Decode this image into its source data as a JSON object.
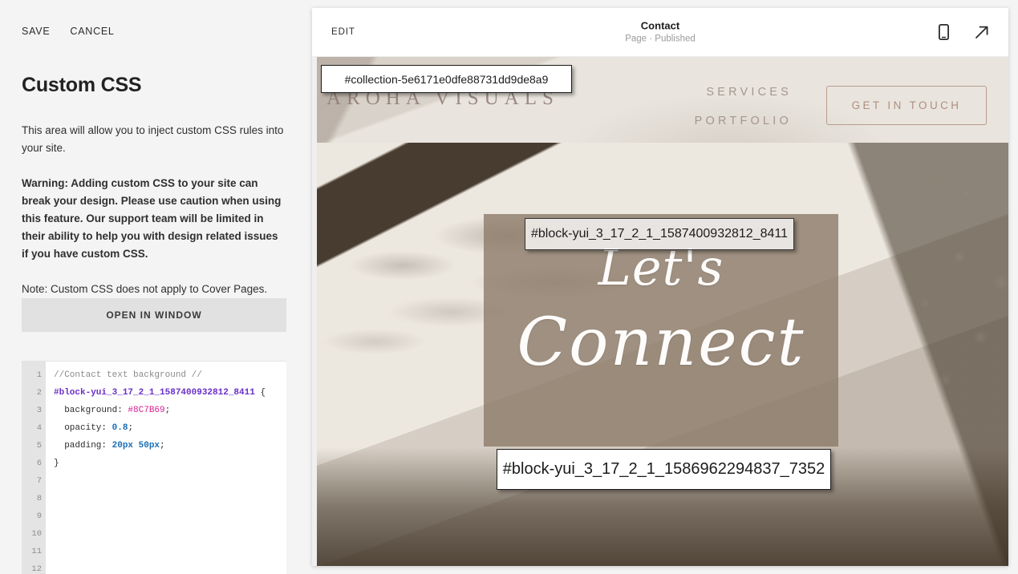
{
  "left_panel": {
    "actions": [
      {
        "id": "save",
        "label": "SAVE"
      },
      {
        "id": "cancel",
        "label": "CANCEL"
      }
    ],
    "title": "Custom CSS",
    "paragraphs": [
      {
        "text": "This area will allow you to inject custom CSS rules into your site.",
        "strong": false
      },
      {
        "text": "Warning: Adding custom CSS to your site can break your design. Please use caution when using this feature. Our support team will be limited in their ability to help you with design related issues if you have custom CSS.",
        "strong": true
      },
      {
        "text": "Note: Custom CSS does not apply to Cover Pages.",
        "strong": false
      }
    ],
    "open_window_label": "OPEN IN WINDOW"
  },
  "editor": {
    "line_numbers": [
      "1",
      "2",
      "3",
      "4",
      "5",
      "6",
      "7",
      "8",
      "9",
      "10",
      "11",
      "12"
    ],
    "lines": [
      {
        "n": 1,
        "comment": "//Contact text background //"
      },
      {
        "n": 2,
        "selector": "#block-yui_3_17_2_1_1587400932812_8411",
        "brace": " {"
      },
      {
        "n": 3,
        "prop": "  background: ",
        "hex": "#8C7B69",
        "semi": ";"
      },
      {
        "n": 4,
        "prop": "  opacity: ",
        "num": "0.8",
        "semi": ";"
      },
      {
        "n": 5,
        "prop": "  padding: ",
        "num": "20px 50px",
        "semi": ";"
      },
      {
        "n": 6,
        "brace": "}"
      }
    ],
    "colors": {
      "comment": "#8a8a8a",
      "selector": "#6b2fc9",
      "hex_value": "#d6208f",
      "number": "#1a6fb5",
      "text": "#2b2b2b",
      "gutter_bg": "#e4e4e4",
      "gutter_text": "#8d8d8d"
    }
  },
  "preview_header": {
    "edit_label": "EDIT",
    "title": "Contact",
    "subtitle": "Page · Published",
    "icons": [
      {
        "name": "mobile-preview-icon"
      },
      {
        "name": "open-external-arrow-icon"
      }
    ]
  },
  "site": {
    "logo": "AROHA VISUALS",
    "nav_links": [
      "SERVICES",
      "PORTFOLIO"
    ],
    "cta_label": "GET IN TOUCH",
    "hero_line1": "Let's",
    "hero_line2": "Connect",
    "colors": {
      "nav_bg": "#e9e5de",
      "logo": "#8e7a73",
      "nav_link": "#a4968d",
      "cta_border": "#b99b8c",
      "cta_text": "#b08e7f",
      "hero_block": "#8C7B69"
    }
  },
  "id_chips": [
    {
      "id": "collection",
      "text": "#collection-5e6171e0dfe88731dd9de8a9"
    },
    {
      "id": "block_top",
      "text": "#block-yui_3_17_2_1_1587400932812_8411"
    },
    {
      "id": "block_bottom",
      "text": "#block-yui_3_17_2_1_1586962294837_7352"
    }
  ]
}
